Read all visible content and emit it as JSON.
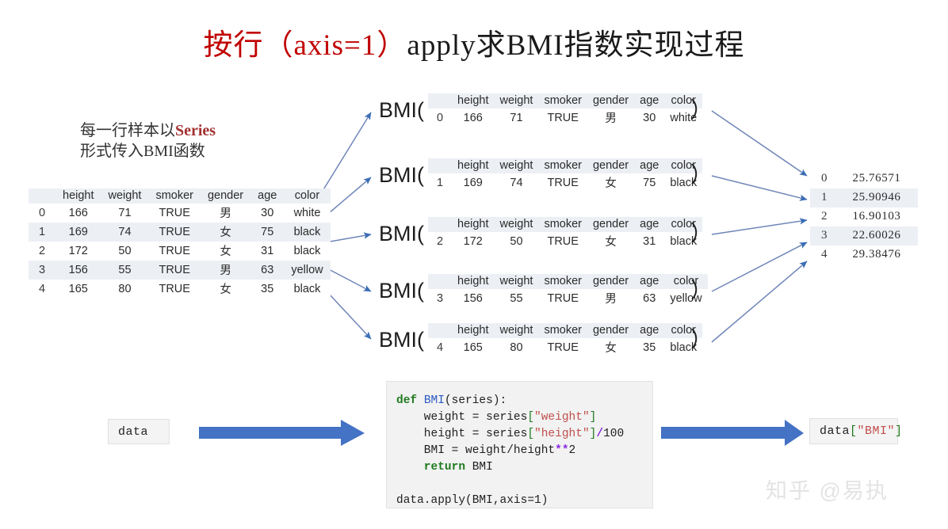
{
  "title": {
    "red_part": "按行（axis=1）",
    "black_part": "apply求BMI指数实现过程"
  },
  "note": {
    "line1_prefix": "每一行样本以",
    "line1_accent": "Series",
    "line2": "形式传入BMI函数"
  },
  "source_table": {
    "columns": [
      "",
      "height",
      "weight",
      "smoker",
      "gender",
      "age",
      "color"
    ],
    "rows": [
      [
        "0",
        "166",
        "71",
        "TRUE",
        "男",
        "30",
        "white"
      ],
      [
        "1",
        "169",
        "74",
        "TRUE",
        "女",
        "75",
        "black"
      ],
      [
        "2",
        "172",
        "50",
        "TRUE",
        "女",
        "31",
        "black"
      ],
      [
        "3",
        "156",
        "55",
        "TRUE",
        "男",
        "63",
        "yellow"
      ],
      [
        "4",
        "165",
        "80",
        "TRUE",
        "女",
        "35",
        "black"
      ]
    ]
  },
  "bmi_calls": [
    {
      "open": "BMI(",
      "close": "）",
      "columns": [
        "",
        "height",
        "weight",
        "smoker",
        "gender",
        "age",
        "color"
      ],
      "values": [
        "0",
        "166",
        "71",
        "TRUE",
        "男",
        "30",
        "white"
      ]
    },
    {
      "open": "BMI(",
      "close": "）",
      "columns": [
        "",
        "height",
        "weight",
        "smoker",
        "gender",
        "age",
        "color"
      ],
      "values": [
        "1",
        "169",
        "74",
        "TRUE",
        "女",
        "75",
        "black"
      ]
    },
    {
      "open": "BMI(",
      "close": "）",
      "columns": [
        "",
        "height",
        "weight",
        "smoker",
        "gender",
        "age",
        "color"
      ],
      "values": [
        "2",
        "172",
        "50",
        "TRUE",
        "女",
        "31",
        "black"
      ]
    },
    {
      "open": "BMI(",
      "close": "）",
      "columns": [
        "",
        "height",
        "weight",
        "smoker",
        "gender",
        "age",
        "color"
      ],
      "values": [
        "3",
        "156",
        "55",
        "TRUE",
        "男",
        "63",
        "yellow"
      ]
    },
    {
      "open": "BMI(",
      "close": "）",
      "columns": [
        "",
        "height",
        "weight",
        "smoker",
        "gender",
        "age",
        "color"
      ],
      "values": [
        "4",
        "165",
        "80",
        "TRUE",
        "女",
        "35",
        "black"
      ]
    }
  ],
  "result_table": {
    "rows": [
      [
        "0",
        "25.76571"
      ],
      [
        "1",
        "25.90946"
      ],
      [
        "2",
        "16.90103"
      ],
      [
        "3",
        "22.60026"
      ],
      [
        "4",
        "29.38476"
      ]
    ]
  },
  "code": {
    "line1_kw": "def",
    "line1_fn": "BMI",
    "line1_rest": "(series):",
    "line2_name": "    weight = series",
    "line2_open": "[",
    "line2_str": "\"weight\"",
    "line2_close": "]",
    "line3_name": "    height = series",
    "line3_open": "[",
    "line3_str": "\"height\"",
    "line3_close": "]",
    "line3_op": "/",
    "line3_num": "100",
    "line4_name": "    BMI = weight/height",
    "line4_op": "**",
    "line4_num": "2",
    "line5_kw": "    return",
    "line5_rest": " BMI",
    "line7": "data.apply(BMI,axis=1)"
  },
  "data_box": {
    "label": "data"
  },
  "result_box": {
    "prefix": "data",
    "open": "[",
    "str": "\"BMI\"",
    "close": "]"
  },
  "watermark": {
    "text": "知乎 @易执"
  },
  "colors": {
    "title_red": "#c00000",
    "accent_red": "#a33131",
    "arrow_blue": "#4472a8",
    "block_arrow_blue": "#4472C4",
    "table_stripe": "#eceff4",
    "code_bg": "#f2f2f2",
    "watermark_gray": "#e3e3e3"
  }
}
